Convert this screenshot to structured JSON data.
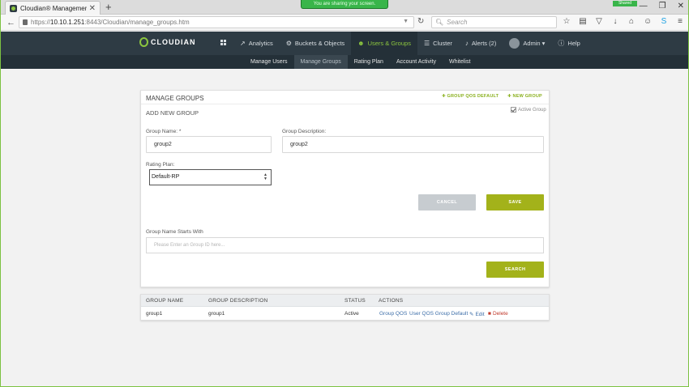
{
  "browser": {
    "tab_title": "Cloudian® Management ...",
    "tab_close": "✕",
    "new_tab": "+",
    "share_banner": "You are sharing your screen.",
    "shared_badge": "Shared",
    "url_prefix": "https://",
    "url_host": "10.10.1.251",
    "url_path": ":8443/Cloudian/manage_groups.htm",
    "search_placeholder": "Search",
    "window_controls": [
      "—",
      "❐",
      "✕"
    ]
  },
  "app": {
    "logo_text": "CLOUDIAN",
    "nav": [
      {
        "label": "Analytics",
        "icon": "📈"
      },
      {
        "label": "Buckets & Objects",
        "icon": "⚙"
      },
      {
        "label": "Users & Groups",
        "icon": "👥"
      },
      {
        "label": "Cluster",
        "icon": "☰"
      },
      {
        "label": "Alerts (2)",
        "icon": "🔔"
      },
      {
        "label": "Admin ▾",
        "icon": ""
      },
      {
        "label": "Help",
        "icon": "?"
      }
    ],
    "subnav": [
      "Manage Users",
      "Manage Groups",
      "Rating Plan",
      "Account Activity",
      "Whitelist"
    ]
  },
  "panel": {
    "title": "MANAGE GROUPS",
    "subtitle": "ADD NEW GROUP",
    "link_qos_default": "✚ GROUP QOS DEFAULT",
    "link_new_group": "✚ NEW GROUP",
    "active_group_label": "Active Group",
    "group_name_label": "Group Name: *",
    "group_name_value": "group2",
    "group_desc_label": "Group Description:",
    "group_desc_value": "group2",
    "rating_plan_label": "Rating Plan:",
    "rating_plan_value": "Default-RP",
    "cancel_label": "CANCEL",
    "save_label": "SAVE",
    "starts_with_label": "Group Name Starts With",
    "starts_with_placeholder": "Please Enter an Group ID here...",
    "search_label": "SEARCH"
  },
  "table": {
    "headers": [
      "GROUP NAME",
      "GROUP DESCRIPTION",
      "STATUS",
      "ACTIONS"
    ],
    "rows": [
      {
        "name": "group1",
        "description": "group1",
        "status": "Active",
        "actions": [
          "Group QOS",
          "User QOS Group Default",
          "Edit",
          "Delete"
        ]
      }
    ]
  }
}
